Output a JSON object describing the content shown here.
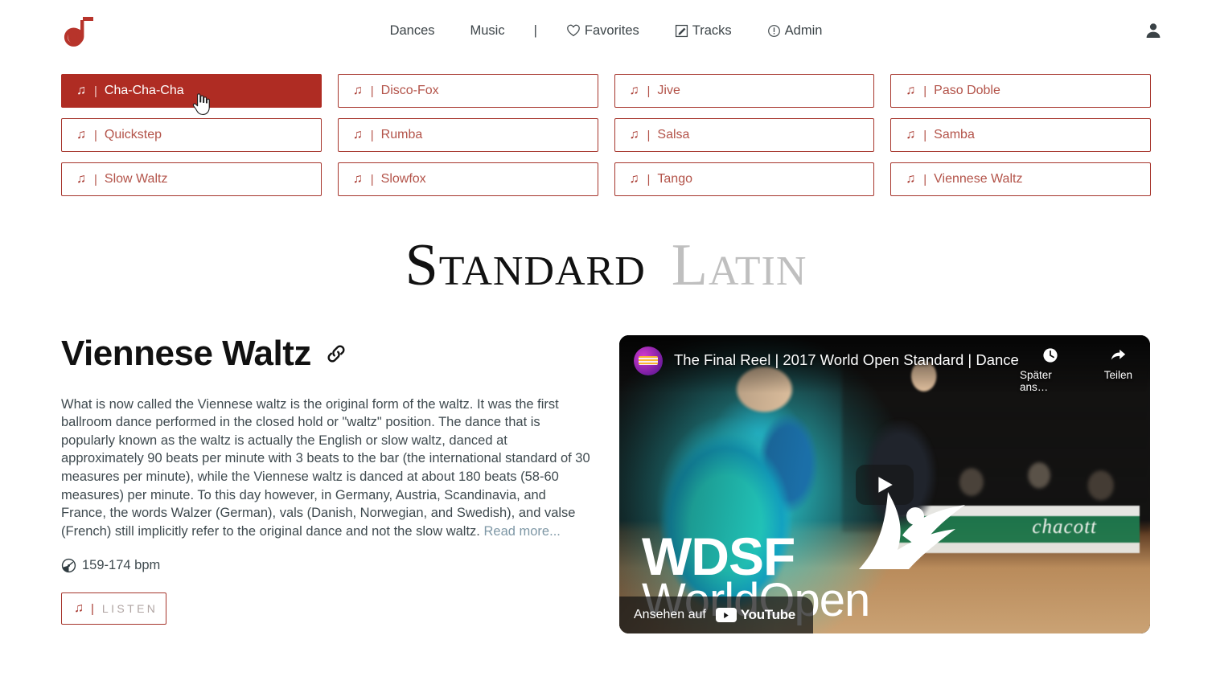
{
  "header": {
    "logo_name": "music-note-d-logo",
    "nav": [
      {
        "label": "Dances",
        "icon": ""
      },
      {
        "label": "Music",
        "icon": ""
      },
      {
        "label": "|",
        "icon": ""
      },
      {
        "label": "Favorites",
        "icon": "heart-icon"
      },
      {
        "label": "Tracks",
        "icon": "edit-icon"
      },
      {
        "label": "Admin",
        "icon": "info-icon"
      }
    ],
    "account_icon": "person-icon"
  },
  "dances": [
    {
      "name": "Cha-Cha-Cha",
      "active": true
    },
    {
      "name": "Disco-Fox",
      "active": false
    },
    {
      "name": "Jive",
      "active": false
    },
    {
      "name": "Paso Doble",
      "active": false
    },
    {
      "name": "Quickstep",
      "active": false
    },
    {
      "name": "Rumba",
      "active": false
    },
    {
      "name": "Salsa",
      "active": false
    },
    {
      "name": "Samba",
      "active": false
    },
    {
      "name": "Slow Waltz",
      "active": false
    },
    {
      "name": "Slowfox",
      "active": false
    },
    {
      "name": "Tango",
      "active": false
    },
    {
      "name": "Viennese Waltz",
      "active": false
    }
  ],
  "section": {
    "standard": "Standard",
    "latin": "Latin"
  },
  "detail": {
    "title": "Viennese Waltz",
    "link_icon": "chain-link-icon",
    "description": "What is now called the Viennese waltz is the original form of the waltz. It was the first ballroom dance performed in the closed hold or \"waltz\" position. The dance that is popularly known as the waltz is actually the English or slow waltz, danced at approximately 90 beats per minute with 3 beats to the bar (the international standard of 30 measures per minute), while the Viennese waltz is danced at about 180 beats (58-60 measures) per minute. To this day however, in Germany, Austria, Scandinavia, and France, the words Walzer (German), vals (Danish, Norwegian, and Swedish), and valse (French) still implicitly refer to the original dance and not the slow waltz. ",
    "read_more": "Read more...",
    "bpm": "159-174 bpm",
    "bpm_icon": "speedometer-icon",
    "listen_label": "LISTEN"
  },
  "video": {
    "title": "The Final Reel | 2017 World Open Standard | Dance…",
    "watch_later": "Später ans…",
    "share": "Teilen",
    "watch_on": "Ansehen auf",
    "youtube": "YouTube",
    "overlay_top": "WDSF",
    "overlay_bottom": "WorldOpen",
    "board_text": "chacott",
    "play_icon": "play-icon",
    "clock_icon": "clock-icon",
    "share_icon": "share-arrow-icon"
  },
  "colors": {
    "accent": "#af2c23",
    "accent_border": "#a6352c",
    "accent_text": "#b35349",
    "link": "#7f98a6",
    "latin_gray": "#bfbfbf"
  }
}
